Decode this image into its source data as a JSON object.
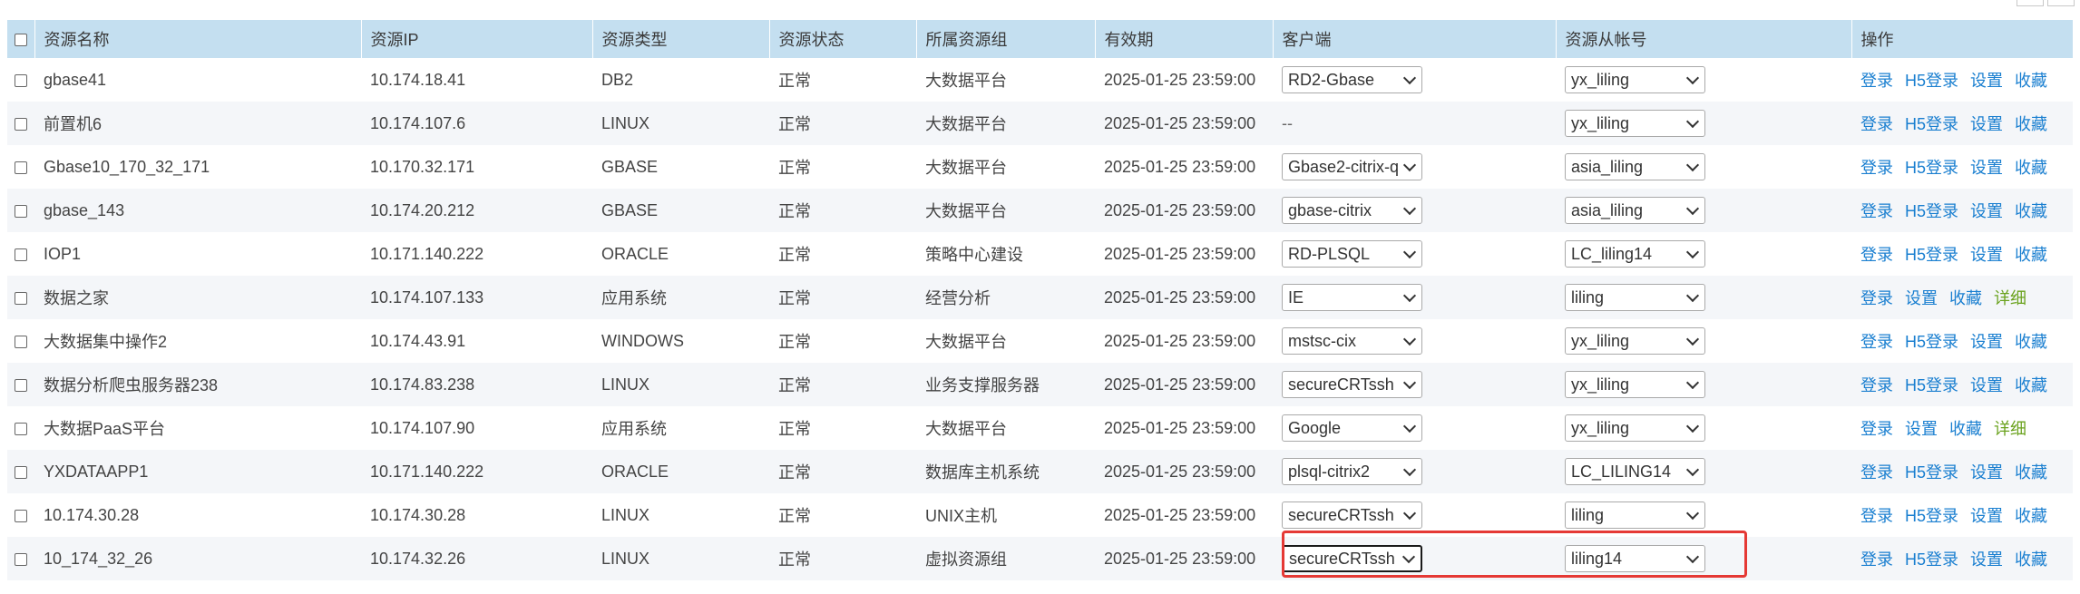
{
  "headers": [
    "资源名称",
    "资源IP",
    "资源类型",
    "资源状态",
    "所属资源组",
    "有效期",
    "客户端",
    "资源从帐号",
    "操作"
  ],
  "rows": [
    {
      "name": "gbase41",
      "ip": "10.174.18.41",
      "type": "DB2",
      "status": "正常",
      "group": "大数据平台",
      "expiry": "2025-01-25 23:59:00",
      "client": "RD2-Gbase",
      "account": "yx_liling",
      "actions": [
        "登录",
        "H5登录",
        "设置",
        "收藏"
      ]
    },
    {
      "name": "前置机6",
      "ip": "10.174.107.6",
      "type": "LINUX",
      "status": "正常",
      "group": "大数据平台",
      "expiry": "2025-01-25 23:59:00",
      "client": "--",
      "account": "yx_liling",
      "actions": [
        "登录",
        "H5登录",
        "设置",
        "收藏"
      ]
    },
    {
      "name": "Gbase10_170_32_171",
      "ip": "10.170.32.171",
      "type": "GBASE",
      "status": "正常",
      "group": "大数据平台",
      "expiry": "2025-01-25 23:59:00",
      "client": "Gbase2-citrix-q",
      "account": "asia_liling",
      "actions": [
        "登录",
        "H5登录",
        "设置",
        "收藏"
      ]
    },
    {
      "name": "gbase_143",
      "ip": "10.174.20.212",
      "type": "GBASE",
      "status": "正常",
      "group": "大数据平台",
      "expiry": "2025-01-25 23:59:00",
      "client": "gbase-citrix",
      "account": "asia_liling",
      "actions": [
        "登录",
        "H5登录",
        "设置",
        "收藏"
      ]
    },
    {
      "name": "IOP1",
      "ip": "10.171.140.222",
      "type": "ORACLE",
      "status": "正常",
      "group": "策略中心建设",
      "expiry": "2025-01-25 23:59:00",
      "client": "RD-PLSQL",
      "account": "LC_liling14",
      "actions": [
        "登录",
        "H5登录",
        "设置",
        "收藏"
      ]
    },
    {
      "name": "数据之家",
      "ip": "10.174.107.133",
      "type": "应用系统",
      "status": "正常",
      "group": "经营分析",
      "expiry": "2025-01-25 23:59:00",
      "client": "IE",
      "account": "liling",
      "actions": [
        "登录",
        "设置",
        "收藏",
        "详细"
      ]
    },
    {
      "name": "大数据集中操作2",
      "ip": "10.174.43.91",
      "type": "WINDOWS",
      "status": "正常",
      "group": "大数据平台",
      "expiry": "2025-01-25 23:59:00",
      "client": "mstsc-cix",
      "account": "yx_liling",
      "actions": [
        "登录",
        "H5登录",
        "设置",
        "收藏"
      ]
    },
    {
      "name": "数据分析爬虫服务器238",
      "ip": "10.174.83.238",
      "type": "LINUX",
      "status": "正常",
      "group": "业务支撑服务器",
      "expiry": "2025-01-25 23:59:00",
      "client": "secureCRTssh",
      "account": "yx_liling",
      "actions": [
        "登录",
        "H5登录",
        "设置",
        "收藏"
      ]
    },
    {
      "name": "大数据PaaS平台",
      "ip": "10.174.107.90",
      "type": "应用系统",
      "status": "正常",
      "group": "大数据平台",
      "expiry": "2025-01-25 23:59:00",
      "client": "Google",
      "account": "yx_liling",
      "actions": [
        "登录",
        "设置",
        "收藏",
        "详细"
      ]
    },
    {
      "name": "YXDATAAPP1",
      "ip": "10.171.140.222",
      "type": "ORACLE",
      "status": "正常",
      "group": "数据库主机系统",
      "expiry": "2025-01-25 23:59:00",
      "client": "plsql-citrix2",
      "account": "LC_LILING14",
      "actions": [
        "登录",
        "H5登录",
        "设置",
        "收藏"
      ]
    },
    {
      "name": "10.174.30.28",
      "ip": "10.174.30.28",
      "type": "LINUX",
      "status": "正常",
      "group": "UNIX主机",
      "expiry": "2025-01-25 23:59:00",
      "client": "secureCRTssh",
      "account": "liling",
      "actions": [
        "登录",
        "H5登录",
        "设置",
        "收藏"
      ]
    },
    {
      "name": "10_174_32_26",
      "ip": "10.174.32.26",
      "type": "LINUX",
      "status": "正常",
      "group": "虚拟资源组",
      "expiry": "2025-01-25 23:59:00",
      "client": "secureCRTssh",
      "account": "liling14",
      "actions": [
        "登录",
        "H5登录",
        "设置",
        "收藏"
      ]
    }
  ],
  "colors": {
    "header_bg": "#c4dff0",
    "link": "#1a7fd0",
    "detail_link": "#6aa21d",
    "highlight": "#e53935"
  }
}
